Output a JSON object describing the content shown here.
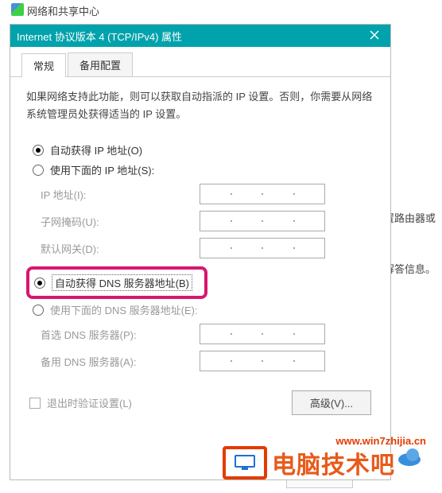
{
  "background": {
    "window_title": "网络和共享中心",
    "right_text_1": "置路由器或",
    "right_text_2": "解答信息。"
  },
  "dialog": {
    "title": "Internet 协议版本 4 (TCP/IPv4) 属性",
    "tabs": {
      "general": "常规",
      "alternate": "备用配置"
    },
    "description": "如果网络支持此功能，则可以获取自动指派的 IP 设置。否则，你需要从网络系统管理员处获得适当的 IP 设置。",
    "ip_section": {
      "auto_label": "自动获得 IP 地址(O)",
      "manual_label": "使用下面的 IP 地址(S):",
      "ip_address": "IP 地址(I):",
      "subnet": "子网掩码(U):",
      "gateway": "默认网关(D):"
    },
    "dns_section": {
      "auto_label": "自动获得 DNS 服务器地址(B)",
      "manual_label": "使用下面的 DNS 服务器地址(E):",
      "preferred": "首选 DNS 服务器(P):",
      "alternate": "备用 DNS 服务器(A):"
    },
    "validate_label": "退出时验证设置(L)",
    "advanced_label": "高级(V)..."
  },
  "watermark": "www.win7zhijia.cn",
  "brand": "电脑技术吧"
}
